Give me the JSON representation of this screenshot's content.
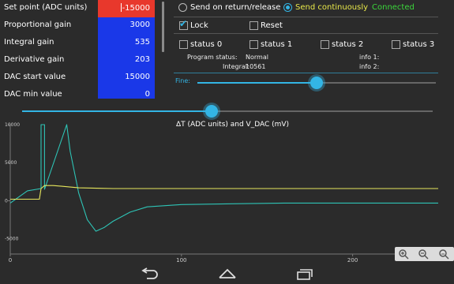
{
  "params": {
    "rows": [
      {
        "label": "Set point (ADC units)",
        "value": "-15000"
      },
      {
        "label": "Proportional gain",
        "value": "3000"
      },
      {
        "label": "Integral gain",
        "value": "535"
      },
      {
        "label": "Derivative gain",
        "value": "203"
      },
      {
        "label": "DAC start value",
        "value": "15000"
      },
      {
        "label": "DAC min value",
        "value": "0"
      }
    ]
  },
  "send": {
    "on_return_label": "Send on return/release",
    "continuous_label": "Send continuously",
    "selected": "continuous",
    "connection_status": "Connected"
  },
  "controls": {
    "lock_label": "Lock",
    "lock_checked": true,
    "reset_label": "Reset",
    "reset_checked": false,
    "status_labels": [
      "status 0",
      "status 1",
      "status 2",
      "status 3"
    ]
  },
  "program": {
    "status_label": "Program status:",
    "status_value": "Normal",
    "integral_label": "Integral:",
    "integral_value": "10561",
    "info1_label": "info 1:",
    "info2_label": "info 2:"
  },
  "fine_slider": {
    "label": "Fine:",
    "fraction": 0.5
  },
  "main_slider": {
    "fraction": 0.47
  },
  "chart_data": {
    "type": "line",
    "title": "ΔT (ADC units) and V_DAC (mV)",
    "xlim": [
      0,
      250
    ],
    "ylim": [
      -7000,
      10000
    ],
    "xticks": [
      "0",
      "100",
      "200"
    ],
    "yticks": [
      "10000",
      "5000",
      "0",
      "-5000"
    ],
    "series": [
      {
        "color": "#2ec4b6",
        "x": [
          0,
          10,
          18,
          18,
          20,
          20,
          33,
          35,
          40,
          45,
          50,
          55,
          60,
          70,
          80,
          100,
          130,
          160,
          200,
          250
        ],
        "y": [
          -300,
          1300,
          1600,
          10000,
          10000,
          1500,
          10000,
          6500,
          1000,
          -2500,
          -4000,
          -3500,
          -2700,
          -1500,
          -800,
          -500,
          -400,
          -300,
          -300,
          -300
        ]
      },
      {
        "color": "#e6e65c",
        "x": [
          0,
          17,
          18,
          20,
          25,
          30,
          40,
          60,
          100,
          150,
          200,
          250
        ],
        "y": [
          200,
          200,
          1600,
          2000,
          2000,
          1900,
          1700,
          1600,
          1600,
          1600,
          1600,
          1600
        ]
      }
    ]
  },
  "colors": {
    "accent": "#33b5e5",
    "param_value_bg": "#1a38e8",
    "setpoint_bg": "#e8382c",
    "connected": "#3bd63b",
    "send_text": "#e8e84a"
  },
  "nav": {
    "icons": [
      "back-icon",
      "home-icon",
      "recent-apps-icon"
    ]
  },
  "zoom": {
    "icons": [
      "zoom-in-icon",
      "zoom-out-icon",
      "zoom-reset-icon"
    ]
  }
}
